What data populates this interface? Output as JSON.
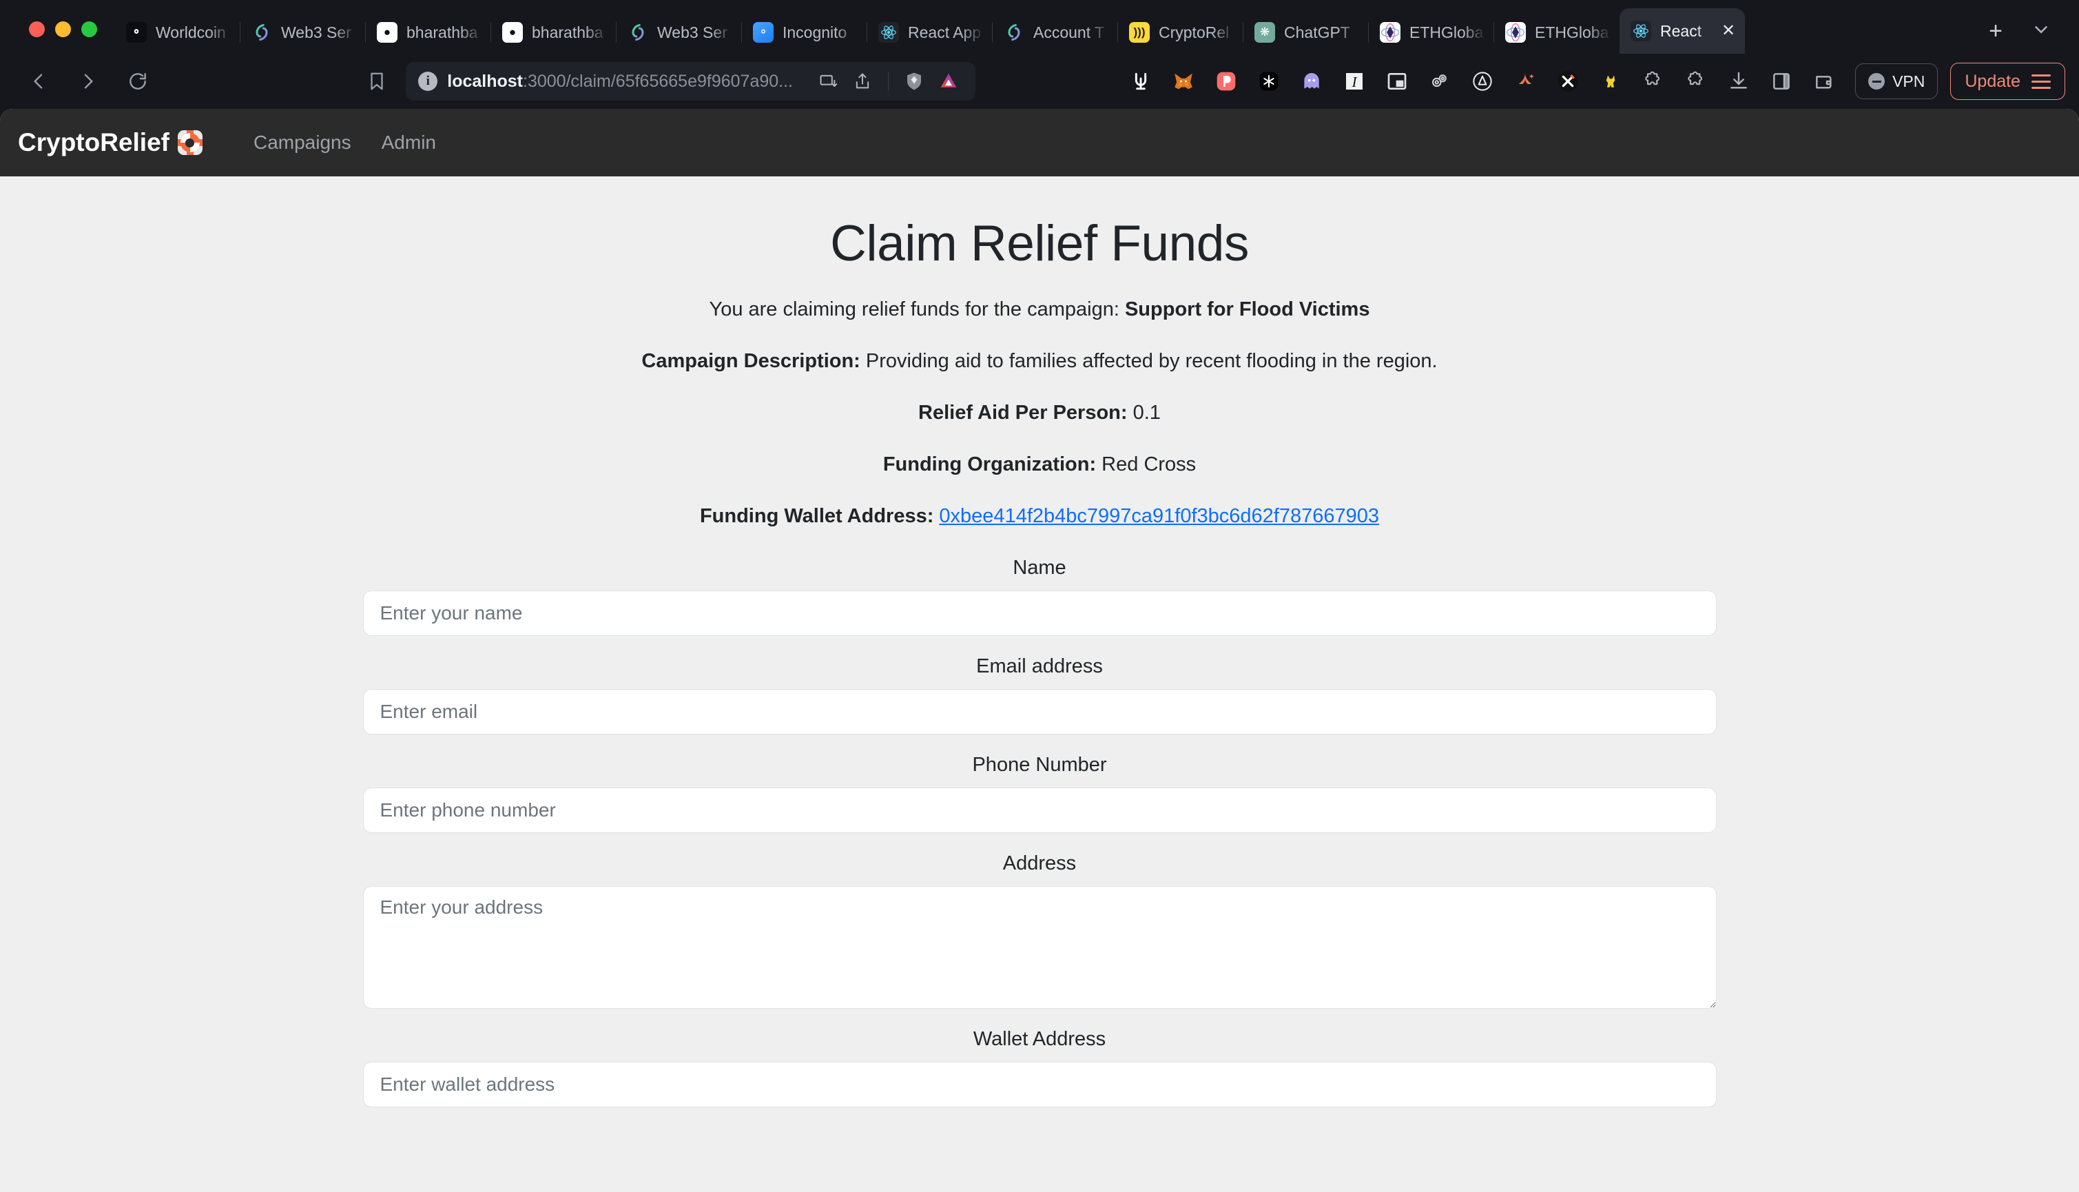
{
  "browser": {
    "window_controls": [
      "close",
      "minimize",
      "maximize"
    ],
    "tabs": [
      {
        "label": "Worldcoin",
        "icon": "worldcoin-icon",
        "active": false
      },
      {
        "label": "Web3 Ser",
        "icon": "web3-icon",
        "active": false
      },
      {
        "label": "bharathba",
        "icon": "github-icon",
        "active": false
      },
      {
        "label": "bharathba",
        "icon": "github-icon",
        "active": false
      },
      {
        "label": "Web3 Ser",
        "icon": "web3-icon",
        "active": false
      },
      {
        "label": "Incognito",
        "icon": "incognito-icon",
        "active": false
      },
      {
        "label": "React App",
        "icon": "react-icon",
        "active": false
      },
      {
        "label": "Account T",
        "icon": "web3-icon",
        "active": false
      },
      {
        "label": "CryptoRel",
        "icon": "crypto-icon",
        "active": false
      },
      {
        "label": "ChatGPT",
        "icon": "chatgpt-icon",
        "active": false
      },
      {
        "label": "ETHGloba",
        "icon": "ethglobal-icon",
        "active": false
      },
      {
        "label": "ETHGloba",
        "icon": "ethglobal-icon",
        "active": false
      },
      {
        "label": "React",
        "icon": "react-icon",
        "active": true
      }
    ],
    "new_tab_label": "+",
    "tab_list_label": "∨",
    "close_tab_label": "✕",
    "nav": {
      "back": "back-icon",
      "forward": "forward-icon",
      "reload": "reload-icon",
      "bookmark": "bookmark-icon"
    },
    "url": {
      "host": "localhost",
      "path": ":3000/claim/65f65665e9f9607a90...",
      "security_label": "i"
    },
    "url_actions": [
      "split-view-icon",
      "share-icon",
      "brave-shields-icon",
      "brave-rewards-icon"
    ],
    "extensions": [
      "rabby-wallet-icon",
      "metamask-icon",
      "phantom-icon",
      "snowflake-icon",
      "ghost-icon",
      "italic-i-icon",
      "picture-in-picture-icon",
      "gears-icon",
      "arbitrum-icon",
      "argent-icon",
      "x-wallet-icon",
      "pikachu-icon",
      "puzzle-icon"
    ],
    "right_icons": [
      "puzzle-icon",
      "download-icon",
      "sidebar-icon",
      "wallet-icon"
    ],
    "vpn_label": "VPN",
    "update_label": "Update"
  },
  "app": {
    "brand": "CryptoRelief",
    "brand_icon": "life-ring-icon",
    "nav_links": [
      "Campaigns",
      "Admin"
    ]
  },
  "page": {
    "title": "Claim Relief Funds",
    "lead_prefix": "You are claiming relief funds for the campaign: ",
    "campaign_name": "Support for Flood Victims",
    "fields": [
      {
        "label": "Campaign Description:",
        "value": " Providing aid to families affected by recent flooding in the region."
      },
      {
        "label": "Relief Aid Per Person:",
        "value": " 0.1"
      },
      {
        "label": "Funding Organization:",
        "value": " Red Cross"
      }
    ],
    "wallet_label": "Funding Wallet Address:",
    "wallet_address": "0xbee414f2b4bc7997ca91f0f3bc6d62f787667903",
    "form": {
      "name": {
        "label": "Name",
        "placeholder": "Enter your name",
        "value": ""
      },
      "email": {
        "label": "Email address",
        "placeholder": "Enter email",
        "value": ""
      },
      "phone": {
        "label": "Phone Number",
        "placeholder": "Enter phone number",
        "value": ""
      },
      "address": {
        "label": "Address",
        "placeholder": "Enter your address",
        "value": ""
      },
      "wallet": {
        "label": "Wallet Address",
        "placeholder": "Enter wallet address",
        "value": ""
      }
    }
  },
  "colors": {
    "link": "#0d6efd",
    "brand_accent": "#f26a3d",
    "update_accent": "#f08a7a",
    "page_bg": "#efefef",
    "navbar_bg": "#2b2b2b",
    "chrome_bg": "#15171c"
  }
}
